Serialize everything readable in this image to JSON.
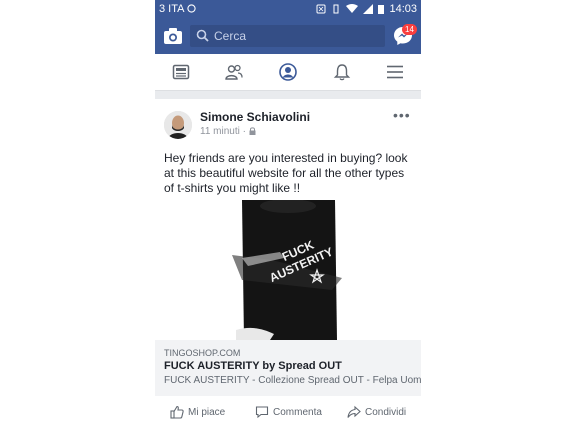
{
  "status_bar": {
    "carrier": "3 ITA",
    "time": "14:03"
  },
  "top_bar": {
    "search_placeholder": "Cerca",
    "messenger_badge": "14"
  },
  "nav": {
    "items": [
      "news-feed",
      "friends",
      "profile",
      "notifications",
      "menu"
    ]
  },
  "post": {
    "author": "Simone Schiavolini",
    "time": "11 minuti",
    "text": "Hey friends are you interested in buying? look at this beautiful website for all the other types of t-shirts you might like !!",
    "shirt_text_line1": "FUCK",
    "shirt_text_line2": "AUSTERITY",
    "link": {
      "domain": "TINGOSHOP.COM",
      "title": "FUCK AUSTERITY by Spread OUT",
      "description": "FUCK AUSTERITY - Collezione Spread OUT - Felpa Uomo..."
    },
    "actions": {
      "like": "Mi piace",
      "comment": "Commenta",
      "share": "Condividi"
    }
  },
  "colors": {
    "brand": "#3b5998",
    "badge": "#fa3e3e",
    "link_bg": "#f2f3f5"
  }
}
